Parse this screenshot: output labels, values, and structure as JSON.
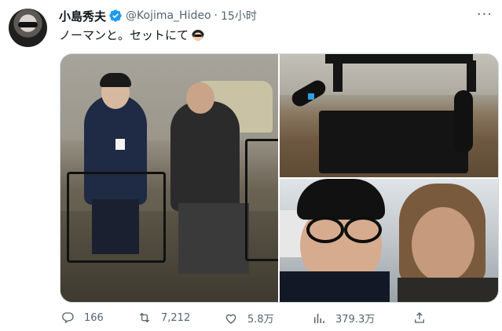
{
  "author": {
    "name": "小島秀夫",
    "handle": "@Kojima_Hideo",
    "separator": "·",
    "time": "15小时",
    "verified": true
  },
  "tweet": {
    "text": "ノーマンと。セットにて",
    "emoji": "glasses-face-emoji"
  },
  "media": {
    "photos": [
      {
        "subject": "two-men-seated-in-folding-chairs"
      },
      {
        "subject": "empty-black-folding-chair"
      },
      {
        "subject": "selfie-two-men-smiling"
      }
    ]
  },
  "actions": {
    "reply_count": "166",
    "retweet_count": "7,212",
    "like_count": "5.8万",
    "view_count": "379.3万"
  },
  "colors": {
    "text": "#0f1419",
    "secondary": "#536471",
    "verified": "#1d9bf0",
    "border": "#cfd9de"
  }
}
